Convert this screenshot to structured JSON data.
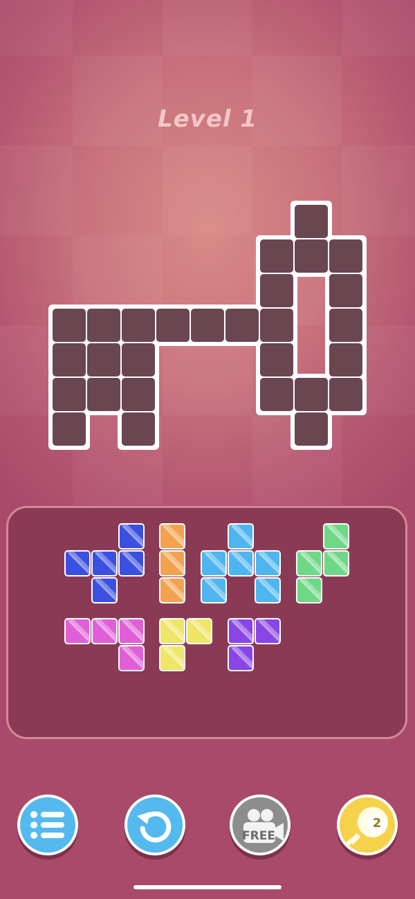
{
  "level_title": "Level 1",
  "colors": {
    "board_cell": "#6a4651",
    "board_outline": "#ffffff",
    "tray_fill": "#8b3a56",
    "tray_border": "#d48a96"
  },
  "board": {
    "cells": [
      [
        3,
        0
      ],
      [
        2,
        1
      ],
      [
        3,
        1
      ],
      [
        4,
        1
      ],
      [
        2,
        2
      ],
      [
        4,
        2
      ],
      [
        -4,
        3
      ],
      [
        -3,
        3
      ],
      [
        -2,
        3
      ],
      [
        -1,
        3
      ],
      [
        0,
        3
      ],
      [
        1,
        3
      ],
      [
        2,
        3
      ],
      [
        4,
        3
      ],
      [
        -4,
        4
      ],
      [
        -3,
        4
      ],
      [
        -2,
        4
      ],
      [
        2,
        4
      ],
      [
        4,
        4
      ],
      [
        -4,
        5
      ],
      [
        -3,
        5
      ],
      [
        -2,
        5
      ],
      [
        2,
        5
      ],
      [
        3,
        5
      ],
      [
        4,
        5
      ],
      [
        -4,
        6
      ],
      [
        -2,
        6
      ],
      [
        3,
        6
      ]
    ]
  },
  "pieces": [
    {
      "name": "blue",
      "color": "#3b4fe0",
      "cells": [
        [
          2,
          0
        ],
        [
          0,
          1
        ],
        [
          1,
          1
        ],
        [
          2,
          1
        ],
        [
          1,
          2
        ]
      ]
    },
    {
      "name": "orange",
      "color": "#f3a24e",
      "cells": [
        [
          0,
          0
        ],
        [
          0,
          1
        ],
        [
          0,
          2
        ]
      ]
    },
    {
      "name": "sky",
      "color": "#4fb5f0",
      "cells": [
        [
          1,
          0
        ],
        [
          0,
          1
        ],
        [
          1,
          1
        ],
        [
          2,
          1
        ],
        [
          0,
          2
        ],
        [
          2,
          2
        ]
      ]
    },
    {
      "name": "green",
      "color": "#6fd886",
      "cells": [
        [
          1,
          0
        ],
        [
          0,
          1
        ],
        [
          1,
          1
        ],
        [
          0,
          2
        ]
      ]
    },
    {
      "name": "pink",
      "color": "#e05fd6",
      "cells": [
        [
          0,
          0
        ],
        [
          1,
          0
        ],
        [
          2,
          0
        ],
        [
          2,
          1
        ]
      ]
    },
    {
      "name": "yellow",
      "color": "#efe566",
      "cells": [
        [
          0,
          0
        ],
        [
          1,
          0
        ],
        [
          0,
          1
        ]
      ]
    },
    {
      "name": "purple",
      "color": "#8a45e6",
      "cells": [
        [
          0,
          0
        ],
        [
          1,
          0
        ],
        [
          0,
          1
        ]
      ]
    }
  ],
  "buttons": {
    "menu_icon": "list-icon",
    "undo_icon": "restart-icon",
    "free_label": "FREE",
    "hint_count": "2"
  }
}
